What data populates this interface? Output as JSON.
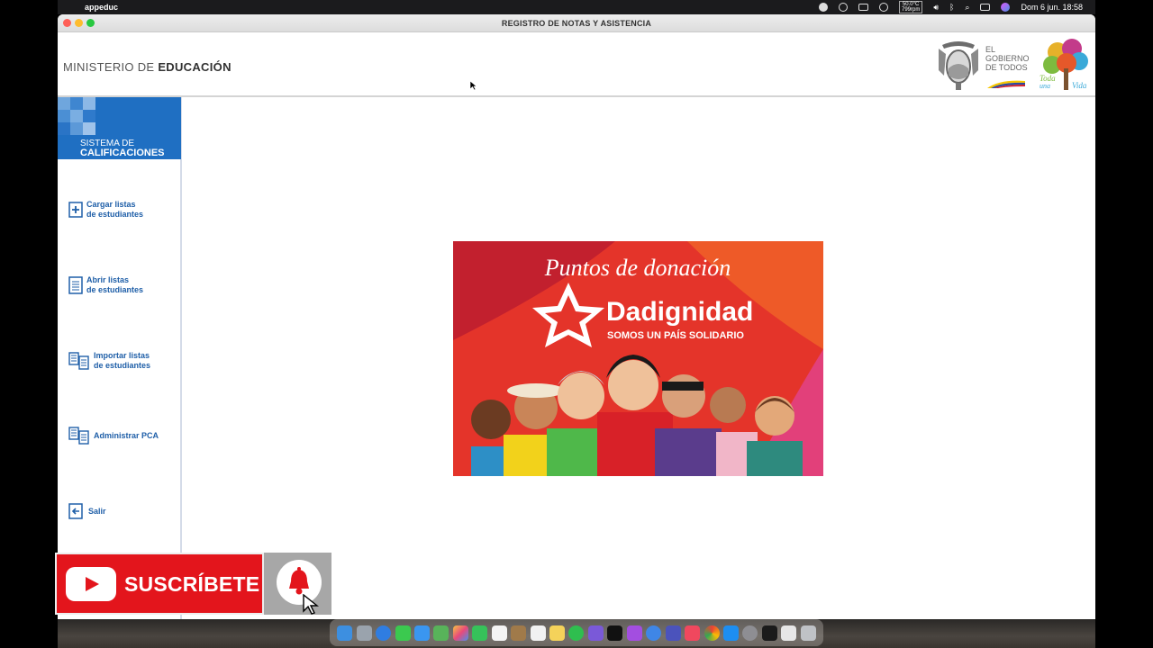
{
  "menubar": {
    "app_name": "appeduc",
    "temp_top": "50.0°C",
    "temp_bottom": "799rpm",
    "clock": "Dom 6 jun.  18:58"
  },
  "window": {
    "title": "REGISTRO DE NOTAS Y ASISTENCIA"
  },
  "header": {
    "ministerio_light": "MINISTERIO DE",
    "ministerio_bold": "EDUCACIÓN",
    "gob_line1": "EL",
    "gob_line2": "GOBIERNO",
    "gob_line3": "DE TODOS",
    "toda_line1": "Toda",
    "toda_line2": "una",
    "toda_line3": "Vida"
  },
  "sidebar": {
    "brand_line1": "SISTEMA DE",
    "brand_line2": "CALIFICACIONES",
    "items": [
      {
        "line1": "Cargar listas",
        "line2": "de estudiantes"
      },
      {
        "line1": "Abrir listas",
        "line2": "de estudiantes"
      },
      {
        "line1": "Importar listas",
        "line2": "de estudiantes"
      },
      {
        "line1": "Administrar PCA",
        "line2": ""
      },
      {
        "line1": "Salir",
        "line2": ""
      }
    ]
  },
  "banner": {
    "heading": "Puntos de donación",
    "brand": "Dadignidad",
    "tagline": "SOMOS UN PAÍS SOLIDARIO"
  },
  "youtube": {
    "label": "SUSCRÍBETE"
  },
  "colors": {
    "brand_blue": "#1f6fc2",
    "nav_text": "#1f5fa8",
    "yt_red": "#e3151c"
  }
}
